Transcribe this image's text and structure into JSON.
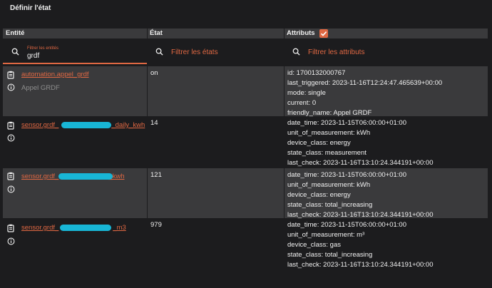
{
  "title": "Définir l'état",
  "columns": {
    "entity": "Entité",
    "state": "État",
    "attributes": "Attributs"
  },
  "filters": {
    "entity_label": "Filtrer les entités",
    "entity_value": "grdf",
    "state_placeholder": "Filtrer les états",
    "attributes_placeholder": "Filtrer les attributs"
  },
  "colors": {
    "accent": "#e06843",
    "redaction": "#18b6d6",
    "row_alt": "#3a3a3c",
    "background": "#1c1c1e"
  },
  "rows": [
    {
      "entity_id": "automation.appel_grdf",
      "friendly": "Appel GRDF",
      "state": "on",
      "attributes": [
        "id: 1700132000767",
        "last_triggered: 2023-11-16T12:24:47.465639+00:00",
        "mode: single",
        "current: 0",
        "friendly_name: Appel GRDF"
      ]
    },
    {
      "entity_id_prefix": "sensor.grdf_",
      "entity_id_suffix": "_daily_kwh",
      "state": "14",
      "attributes": [
        "date_time: 2023-11-15T06:00:00+01:00",
        "unit_of_measurement: kWh",
        "device_class: energy",
        "state_class: measurement",
        "last_check: 2023-11-16T13:10:24.344191+00:00"
      ]
    },
    {
      "entity_id_prefix": "sensor.grdf_",
      "entity_id_suffix": "_kwh",
      "state": "121",
      "attributes": [
        "date_time: 2023-11-15T06:00:00+01:00",
        "unit_of_measurement: kWh",
        "device_class: energy",
        "state_class: total_increasing",
        "last_check: 2023-11-16T13:10:24.344191+00:00"
      ]
    },
    {
      "entity_id_prefix": "sensor.grdf_",
      "entity_id_suffix": "_m3",
      "state": "979",
      "attributes": [
        "date_time: 2023-11-15T06:00:00+01:00",
        "unit_of_measurement: m³",
        "device_class: gas",
        "state_class: total_increasing",
        "last_check: 2023-11-16T13:10:24.344191+00:00"
      ]
    }
  ]
}
